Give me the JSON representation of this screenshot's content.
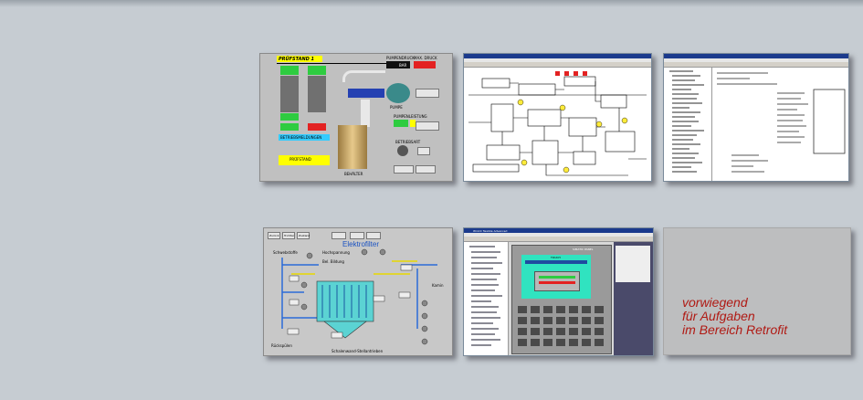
{
  "thumbs": {
    "pruefstand": {
      "title": "PRÜFSTAND 1",
      "pumpendruck": "PUMPENDRUCK",
      "max_druck": "MAX. DRUCK",
      "bar": "BAR",
      "betriebsmeldungen": "BETRIEBSMELDUNGEN",
      "pumpe": "PUMPE",
      "behaelter": "BEHÄLTER",
      "pruefstand_label": "PRÜFSTAND",
      "pumpenleistung": "PUMPENLEISTUNG",
      "betriebsart": "BETRIEBSART"
    },
    "elektrofilter": {
      "title": "Elektrofilter",
      "buttons": [
        "Zurück",
        "Trichter",
        "Zustand"
      ],
      "hochspannung": "Hochspannung",
      "bel_bildung": "Bel. Bildung",
      "schwebstoffe": "Schwebstoffe",
      "kamin": "Kamin",
      "rueckspuelen": "Rückspülen",
      "schalenstellungen": "Schalenwand-Stellantrieben"
    },
    "wincc": {
      "title": "WinCC flexible Advanced",
      "panel": "SIMATIC PANEL",
      "touch": "TOUCH"
    }
  },
  "caption": {
    "line1": "vorwiegend",
    "line2": "für Aufgaben",
    "line3": "im Bereich Retrofit"
  },
  "colors": {
    "background": "#c6ccd2",
    "caption": "#b01a14"
  }
}
